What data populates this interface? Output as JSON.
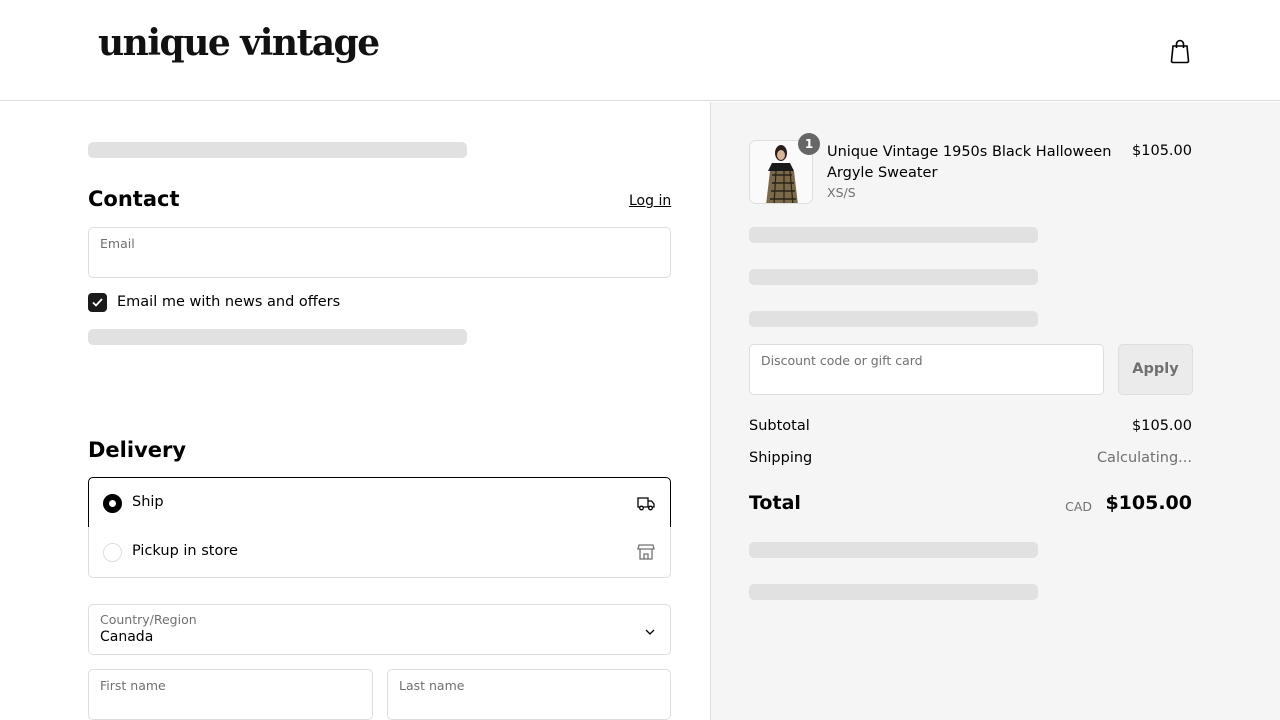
{
  "header": {
    "logo": "unique vintage",
    "cart_icon": "shopping-bag-icon"
  },
  "contact": {
    "title": "Contact",
    "login_label": "Log in",
    "email_label": "Email",
    "email_value": "",
    "newsletter_label": "Email me with news and offers",
    "newsletter_checked": true
  },
  "delivery": {
    "title": "Delivery",
    "options": [
      {
        "label": "Ship",
        "selected": true,
        "icon": "truck-icon"
      },
      {
        "label": "Pickup in store",
        "selected": false,
        "icon": "store-icon"
      }
    ],
    "country_label": "Country/Region",
    "country_value": "Canada",
    "first_name_label": "First name",
    "last_name_label": "Last name"
  },
  "summary": {
    "item": {
      "name": "Unique Vintage 1950s Black Halloween Argyle Sweater",
      "variant": "XS/S",
      "price": "$105.00",
      "quantity": "1"
    },
    "discount_placeholder": "Discount code or gift card",
    "apply_label": "Apply",
    "subtotal_label": "Subtotal",
    "subtotal_value": "$105.00",
    "shipping_label": "Shipping",
    "shipping_value": "Calculating...",
    "total_label": "Total",
    "currency": "CAD",
    "total_value": "$105.00"
  },
  "colors": {
    "accent": "#000000",
    "panel_bg": "#f5f5f5",
    "border": "#dedede",
    "skeleton": "#e1e1e1"
  }
}
